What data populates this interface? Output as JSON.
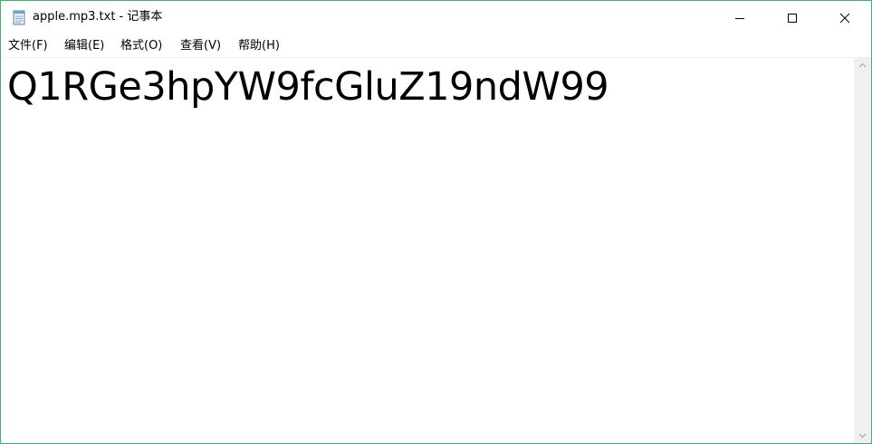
{
  "window": {
    "title": "apple.mp3.txt - 记事本",
    "icons": {
      "app": "notepad-icon",
      "minimize": "minimize-icon",
      "maximize": "maximize-icon",
      "close": "close-icon"
    }
  },
  "menu": {
    "items": [
      {
        "label": "文件(F)"
      },
      {
        "label": "编辑(E)"
      },
      {
        "label": "格式(O)"
      },
      {
        "label": "查看(V)"
      },
      {
        "label": "帮助(H)"
      }
    ]
  },
  "editor": {
    "content": "Q1RGe3hpYW9fcGluZ19ndW99"
  },
  "scrollbar": {
    "up_icon": "scroll-up-arrow-icon",
    "down_icon": "scroll-down-arrow-icon"
  },
  "colors": {
    "window_border": "#3cb371",
    "scrollbar_track": "#f0f0f0"
  }
}
